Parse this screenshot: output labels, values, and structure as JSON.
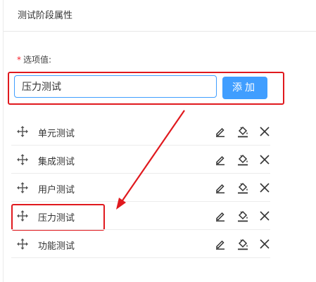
{
  "panel": {
    "title": "测试阶段属性"
  },
  "form": {
    "required_mark": "*",
    "label": "选项值:",
    "input_value": "压力测试",
    "add_button_label": "添加"
  },
  "options": [
    {
      "label": "单元测试"
    },
    {
      "label": "集成测试"
    },
    {
      "label": "用户测试"
    },
    {
      "label": "压力测试"
    },
    {
      "label": "功能测试"
    }
  ],
  "icons": {
    "drag": "drag-move-icon",
    "edit": "edit-pencil-icon",
    "fill": "fill-bucket-icon",
    "close": "close-icon"
  },
  "colors": {
    "accent": "#409eff",
    "annotation": "#e0191e",
    "required": "#f5222d"
  }
}
